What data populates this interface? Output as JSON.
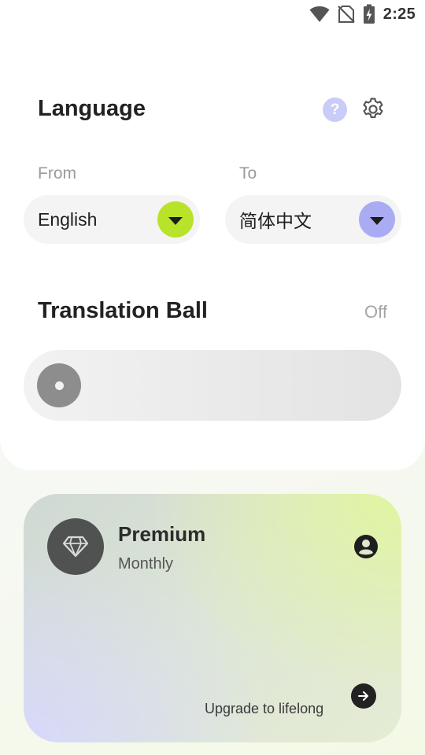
{
  "status_bar": {
    "time": "2:25",
    "icons": [
      "wifi-icon",
      "no-sim-icon",
      "battery-charging-icon"
    ]
  },
  "language": {
    "title": "Language",
    "help_icon_glyph": "?",
    "from_label": "From",
    "to_label": "To",
    "from_value": "English",
    "to_value": "简体中文",
    "from_button_color": "#b8e32a",
    "to_button_color": "#a9acf3"
  },
  "translation_ball": {
    "title": "Translation Ball",
    "state": "Off"
  },
  "premium": {
    "title": "Premium",
    "plan": "Monthly",
    "upgrade_text": "Upgrade to lifelong",
    "icons": [
      "diamond-icon",
      "account-icon",
      "arrow-right-icon"
    ]
  }
}
